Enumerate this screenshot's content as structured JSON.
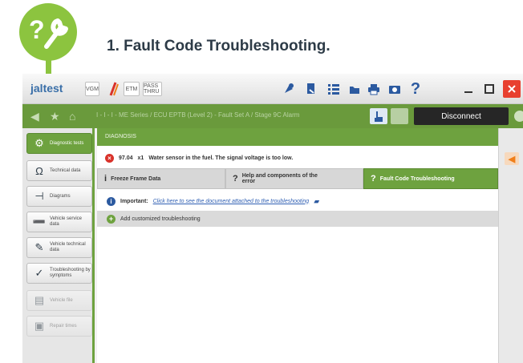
{
  "heading": {
    "title": "1. Fault Code Troubleshooting."
  },
  "badge": {
    "icon": "question-wrench-icon",
    "color": "#8cc43f",
    "symbol": "?"
  },
  "topbar": {
    "brand": "jaltest",
    "chips": [
      "VGM",
      "ETM",
      "PASS THRU"
    ],
    "help": "?"
  },
  "navbar": {
    "breadcrumb": "I - I - I - ME Series / ECU EPTB (Level 2) - Fault Set A / Stage 9C Alarm",
    "disconnect": "Disconnect"
  },
  "sidebar": {
    "items": [
      {
        "label": "Diagnostic tests",
        "icon": "diagnosis-icon",
        "glyph": "⚙",
        "active": true
      },
      {
        "label": "Technical data",
        "icon": "ohm-icon",
        "glyph": "Ω"
      },
      {
        "label": "Diagrams",
        "icon": "diagram-icon",
        "glyph": "⊣"
      },
      {
        "label": "Vehicle service data",
        "icon": "service-icon",
        "glyph": "➖"
      },
      {
        "label": "Vehicle technical data",
        "icon": "technical-icon",
        "glyph": "✎"
      },
      {
        "label": "Troubleshooting by symptoms",
        "icon": "symptom-icon",
        "glyph": "✓"
      },
      {
        "label": "Vehicle file",
        "icon": "file-icon",
        "glyph": "▤",
        "disabled": true
      },
      {
        "label": "Repair times",
        "icon": "repair-icon",
        "glyph": "▣",
        "disabled": true
      }
    ]
  },
  "main": {
    "section_title": "DIAGNOSIS",
    "fault": {
      "code": "97.04",
      "count": "x1",
      "description": "Water sensor in the fuel. The signal voltage is too low."
    },
    "tabs": [
      {
        "label": "Freeze Frame Data",
        "icon": "freeze-icon",
        "glyph": "i"
      },
      {
        "label": "Help and components of the error",
        "icon": "help-icon",
        "glyph": "?"
      },
      {
        "label": "Fault Code Troubleshooting",
        "icon": "troubleshoot-icon",
        "glyph": "?"
      }
    ],
    "important_label": "Important:",
    "important_link": "Click here to see the document attached to the troubleshooting",
    "add_label": "Add customized troubleshooting"
  },
  "colors": {
    "accent": "#6ea23f",
    "danger": "#d9322a",
    "info": "#2c5aa0"
  }
}
